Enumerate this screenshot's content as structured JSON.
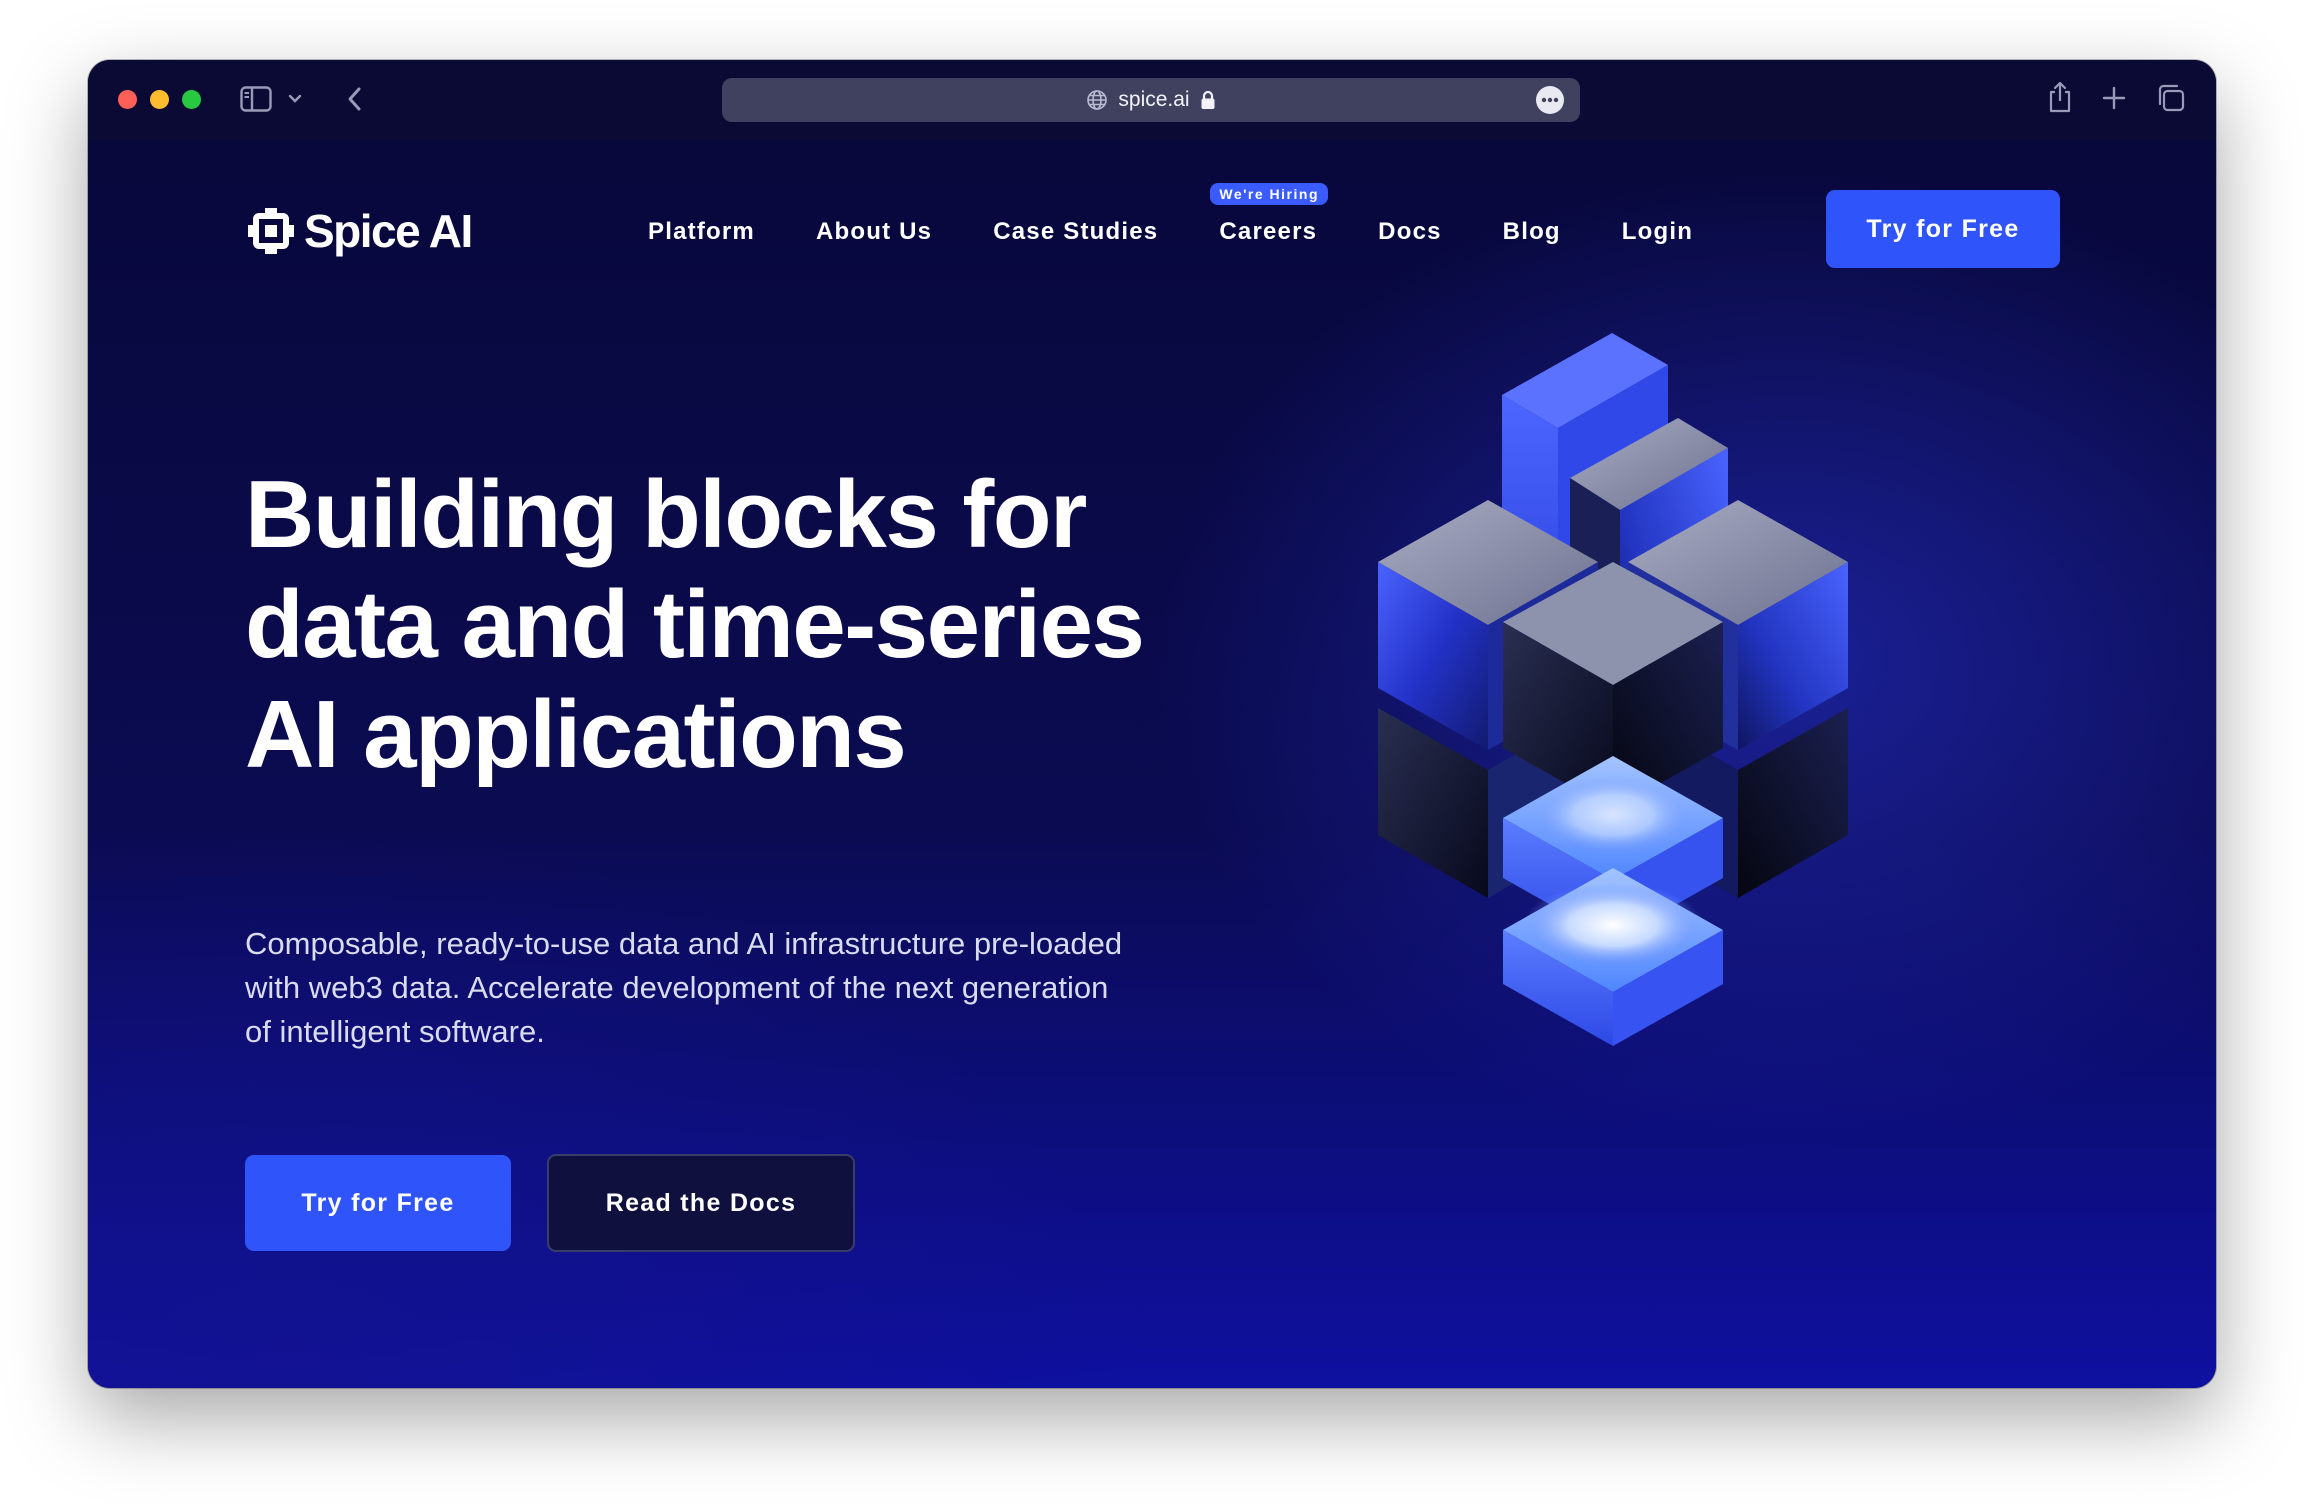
{
  "browser": {
    "url": "spice.ai",
    "icons": [
      "sidebar-icon",
      "chevron-down-icon",
      "back-icon",
      "globe-icon",
      "lock-icon",
      "more-icon",
      "share-icon",
      "plus-icon",
      "tabs-icon"
    ]
  },
  "brand": {
    "name": "Spice AI"
  },
  "nav": {
    "items": [
      "Platform",
      "About Us",
      "Case Studies",
      "Careers",
      "Docs",
      "Blog",
      "Login"
    ],
    "badge": "We're Hiring",
    "cta": "Try for Free"
  },
  "hero": {
    "headline_lines": [
      "Building blocks for",
      "data and time-series",
      "AI applications"
    ],
    "subtext_lines": [
      "Composable, ready-to-use data and AI infrastructure pre-loaded",
      "with web3 data. Accelerate development of the next generation",
      "of intelligent software."
    ],
    "primary_cta": "Try for Free",
    "secondary_cta": "Read the Docs"
  },
  "colors": {
    "background": "#08083c",
    "accent": "#2f54fa",
    "cube_blue": "#3d5cf5",
    "cube_steel": "#8e93ad"
  }
}
